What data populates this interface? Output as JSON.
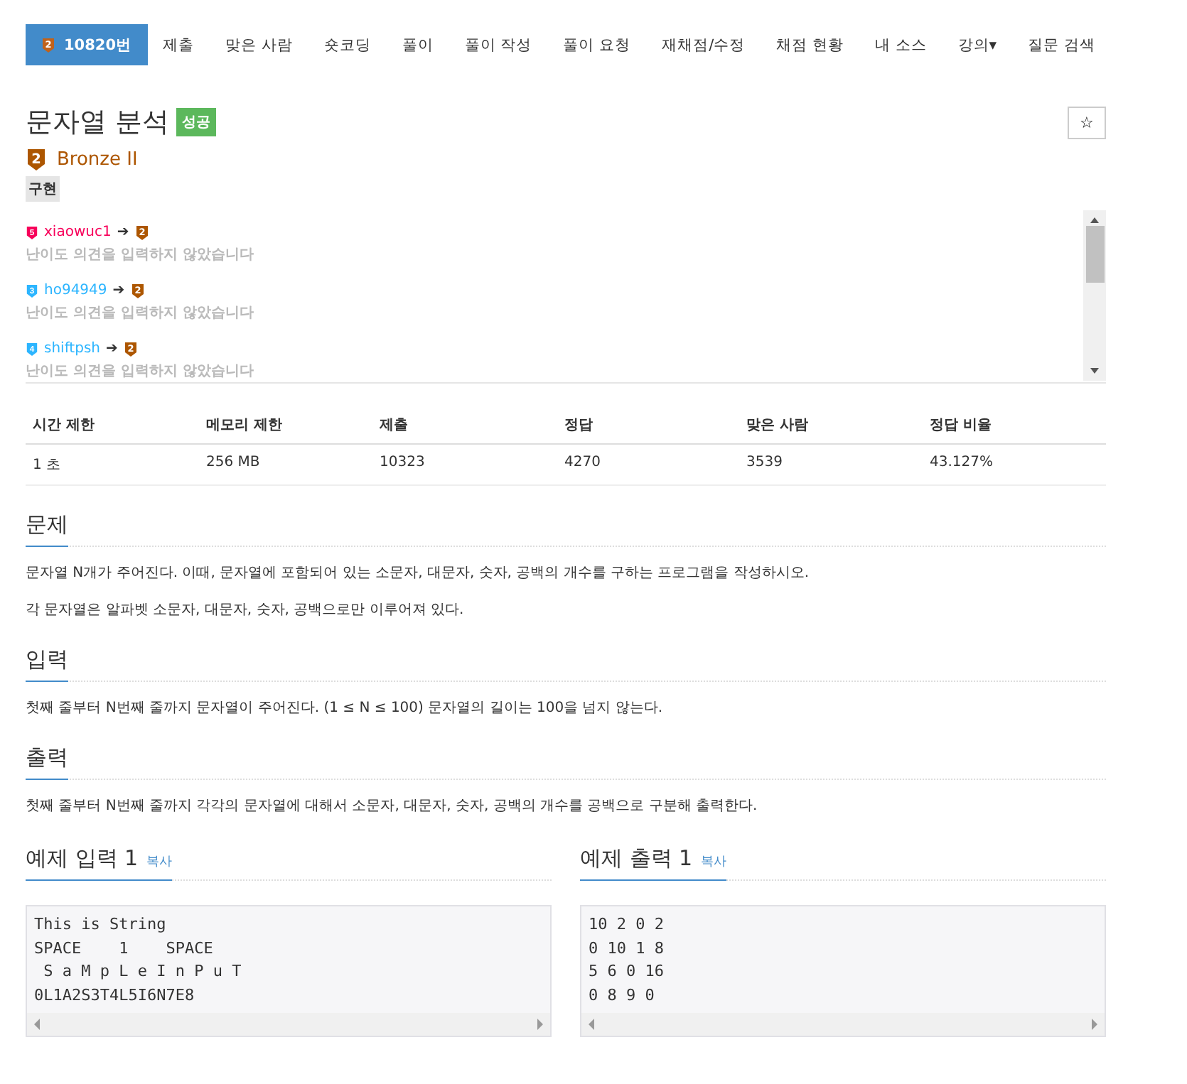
{
  "nav": {
    "items": [
      {
        "label": "10820번",
        "selected": true,
        "tier": "2"
      },
      {
        "label": "제출",
        "selected": false
      },
      {
        "label": "맞은 사람",
        "selected": false
      },
      {
        "label": "숏코딩",
        "selected": false
      },
      {
        "label": "풀이",
        "selected": false
      },
      {
        "label": "풀이 작성",
        "selected": false
      },
      {
        "label": "풀이 요청",
        "selected": false
      },
      {
        "label": "재채점/수정",
        "selected": false
      },
      {
        "label": "채점 현황",
        "selected": false
      },
      {
        "label": "내 소스",
        "selected": false
      },
      {
        "label": "강의▾",
        "selected": false
      },
      {
        "label": "질문 검색",
        "selected": false
      }
    ]
  },
  "problem": {
    "title": "문자열 분석",
    "result": "성공",
    "star": "☆",
    "tier_number": "2",
    "tier": "Bronze II",
    "tag": "구현"
  },
  "opinions": [
    {
      "tier_number": "5",
      "color": "#f7005a",
      "user": "xiaowuc1",
      "arrow": "➔",
      "to_tier": "2",
      "comment": "난이도 의견을 입력하지 않았습니다"
    },
    {
      "tier_number": "3",
      "color": "#2cb5ff",
      "user": "ho94949",
      "arrow": "➔",
      "to_tier": "2",
      "comment": "난이도 의견을 입력하지 않았습니다"
    },
    {
      "tier_number": "4",
      "color": "#2cb5ff",
      "user": "shiftpsh",
      "arrow": "➔",
      "to_tier": "2",
      "comment": "난이도 의견을 입력하지 않았습니다"
    }
  ],
  "info": {
    "columns": [
      "시간 제한",
      "메모리 제한",
      "제출",
      "정답",
      "맞은 사람",
      "정답 비율"
    ],
    "row": [
      "1 초",
      "256 MB",
      "10323",
      "4270",
      "3539",
      "43.127%"
    ]
  },
  "sections": [
    {
      "title": "문제",
      "paragraphs": [
        "문자열 N개가 주어진다. 이때, 문자열에 포함되어 있는 소문자, 대문자, 숫자, 공백의 개수를 구하는 프로그램을 작성하시오.",
        "각 문자열은 알파벳 소문자, 대문자, 숫자, 공백으로만 이루어져 있다."
      ]
    },
    {
      "title": "입력",
      "paragraphs": [
        "첫째 줄부터 N번째 줄까지 문자열이 주어진다. (1 ≤ N ≤ 100) 문자열의 길이는 100을 넘지 않는다."
      ]
    },
    {
      "title": "출력",
      "paragraphs": [
        "첫째 줄부터 N번째 줄까지 각각의 문자열에 대해서 소문자, 대문자, 숫자, 공백의 개수를 공백으로 구분해 출력한다."
      ]
    }
  ],
  "samples": [
    {
      "title": "예제 입력 1",
      "copy": "복사",
      "lines": [
        "This is String",
        "SPACE    1    SPACE",
        " S a M p L e I n P u T",
        "0L1A2S3T4L5I6N7E8"
      ]
    },
    {
      "title": "예제 출력 1",
      "copy": "복사",
      "lines": [
        "10 2 0 2",
        "0 10 1 8",
        "5 6 0 16",
        "0 8 9 0"
      ]
    }
  ]
}
